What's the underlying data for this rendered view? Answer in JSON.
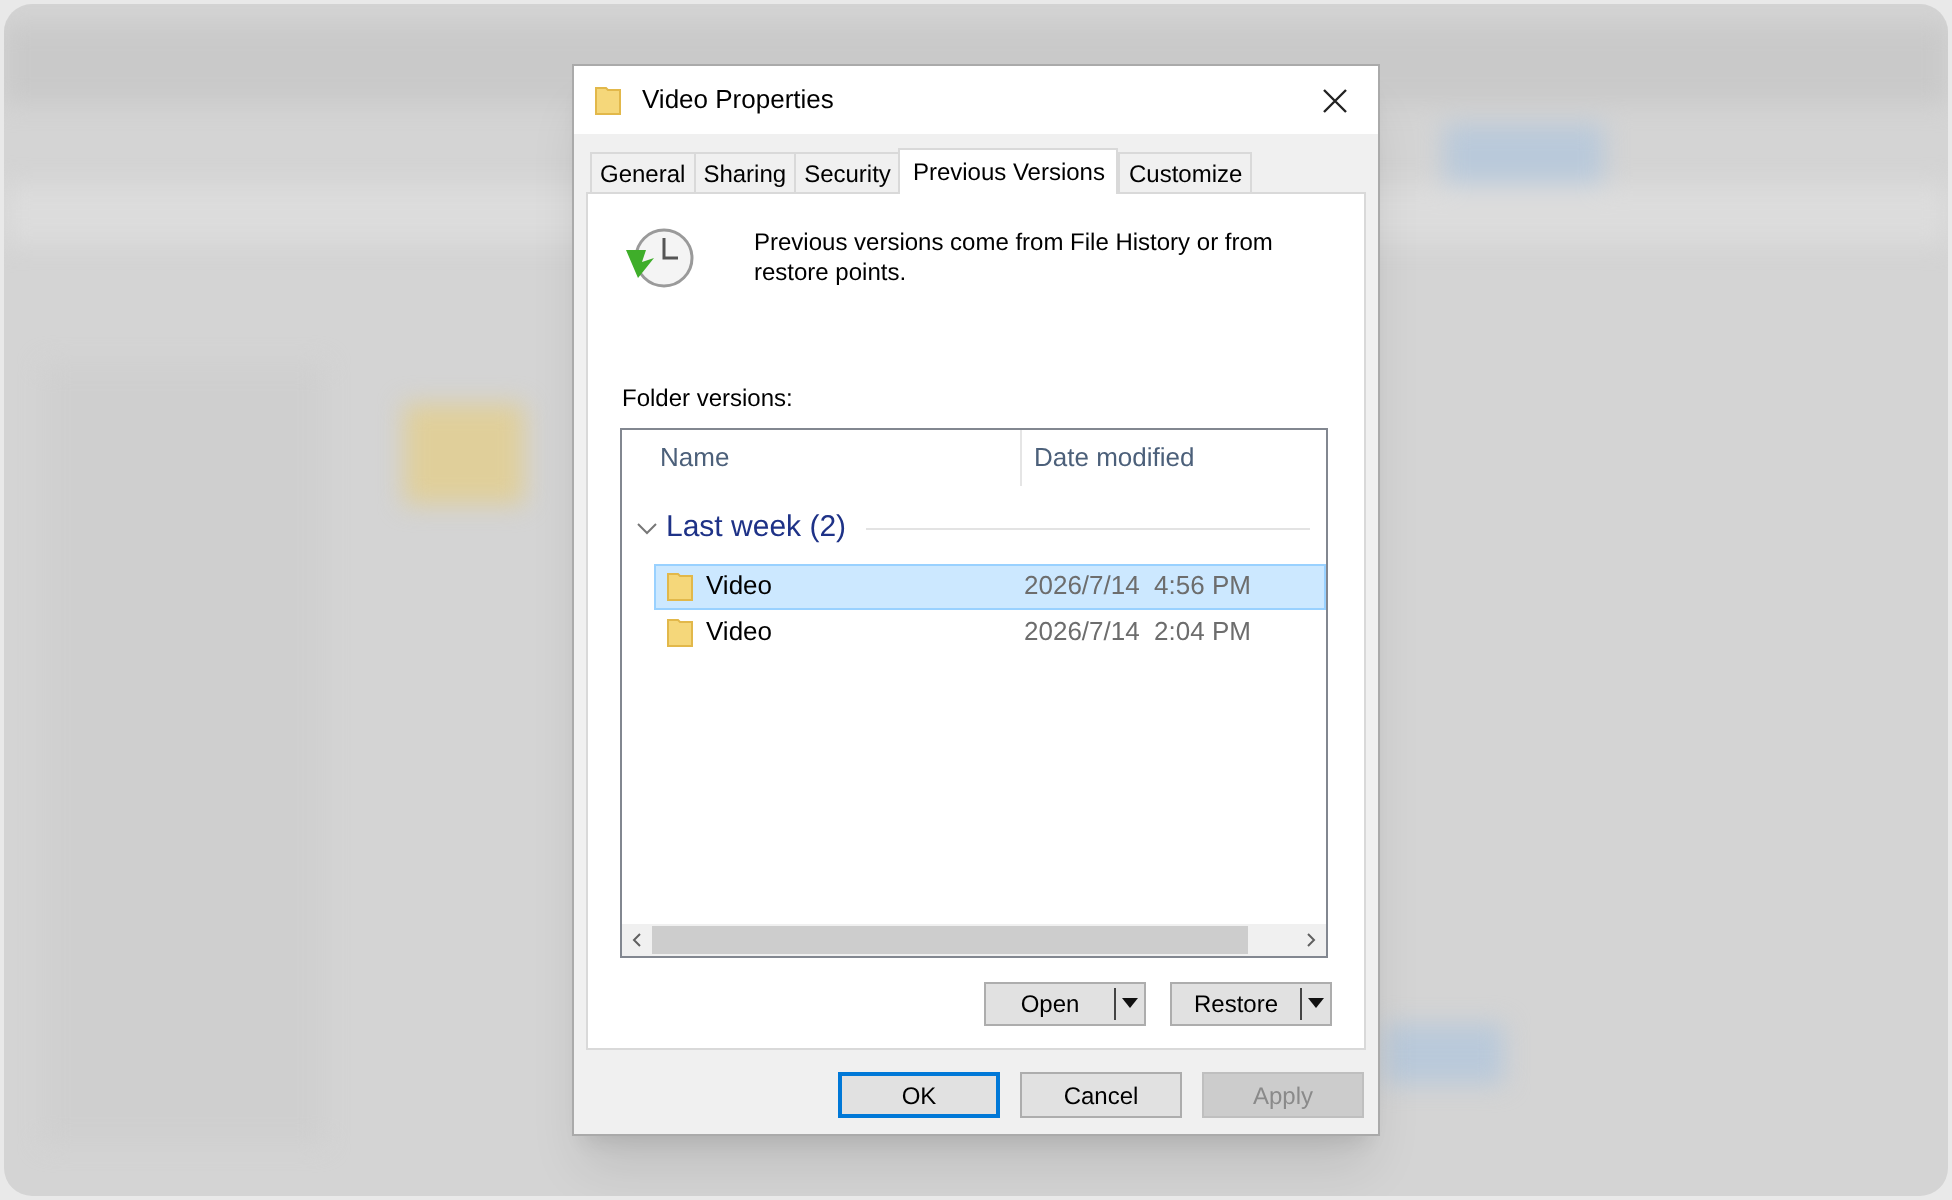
{
  "window": {
    "title": "Video Properties"
  },
  "tabs": [
    {
      "label": "General",
      "selected": false
    },
    {
      "label": "Sharing",
      "selected": false
    },
    {
      "label": "Security",
      "selected": false
    },
    {
      "label": "Previous Versions",
      "selected": true
    },
    {
      "label": "Customize",
      "selected": false
    }
  ],
  "intro": "Previous versions come from File History or from restore points.",
  "list_label": "Folder versions:",
  "columns": [
    "Name",
    "Date modified"
  ],
  "group": {
    "label": "Last week (2)",
    "expanded": true
  },
  "rows": [
    {
      "name": "Video",
      "date": "2026/7/14  4:56 PM",
      "selected": true
    },
    {
      "name": "Video",
      "date": "2026/7/14  2:04 PM",
      "selected": false
    }
  ],
  "actions": [
    "Open",
    "Restore"
  ],
  "buttons": [
    {
      "label": "OK",
      "default": true,
      "disabled": false
    },
    {
      "label": "Cancel",
      "default": false,
      "disabled": false
    },
    {
      "label": "Apply",
      "default": false,
      "disabled": true
    }
  ]
}
